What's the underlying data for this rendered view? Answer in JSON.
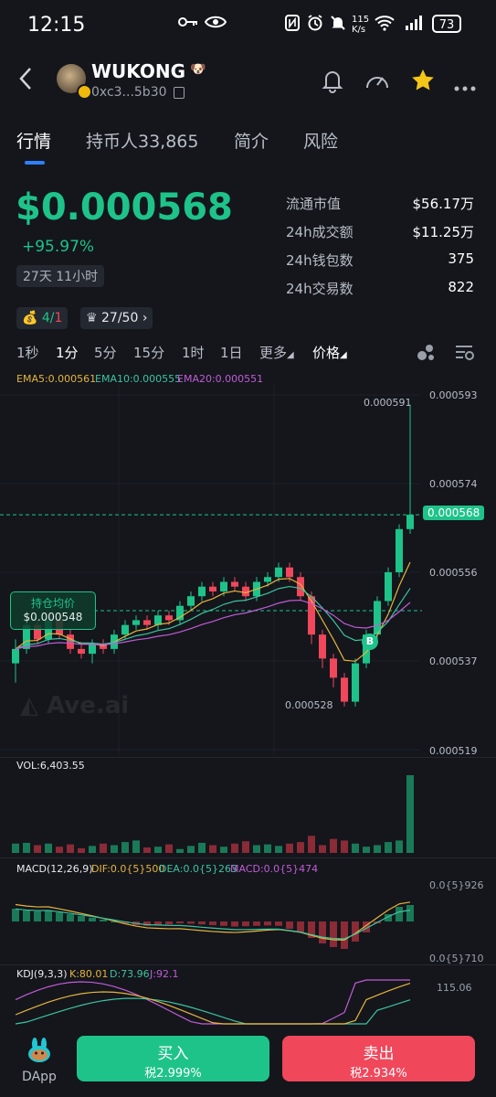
{
  "status_bar": {
    "time": "12:15",
    "net_speed": "115 K/s",
    "battery": "73"
  },
  "header": {
    "title": "WUKONG",
    "address": "0xc3...5b30"
  },
  "tabs": [
    {
      "label": "行情"
    },
    {
      "label": "持币人33,865"
    },
    {
      "label": "简介"
    },
    {
      "label": "风险"
    }
  ],
  "price": {
    "value": "$0.000568",
    "change": "+95.97%",
    "age": "27天 11小时"
  },
  "stats": [
    {
      "label": "流通市值",
      "value": "$56.17万"
    },
    {
      "label": "24h成交额",
      "value": "$11.25万"
    },
    {
      "label": "24h钱包数",
      "value": "375"
    },
    {
      "label": "24h交易数",
      "value": "822"
    }
  ],
  "pills": {
    "moneybag_a": "4/",
    "moneybag_b": "1",
    "crown": "27/50"
  },
  "timeframes": [
    "1秒",
    "1分",
    "5分",
    "15分",
    "1时",
    "1日",
    "更多",
    "价格"
  ],
  "ema": {
    "ema5": "EMA5:0.000561",
    "ema10": "EMA10:0.000555",
    "ema20": "EMA20:0.000551"
  },
  "chart_labels": {
    "high": "0.000591",
    "low": "0.000528",
    "current": "0.000568",
    "avg_title": "持仓均价",
    "avg_value": "$0.000548",
    "buy_marker": "B",
    "watermark": "Ave.ai"
  },
  "vol_label": "VOL:6,403.55",
  "macd": {
    "title": "MACD(12,26,9)",
    "dif": "DIF:0.0{5}500",
    "dea": "DEA:0.0{5}263",
    "macd": "MACD:0.0{5}474",
    "top": "0.0{5}926",
    "bottom": "0.0{5}710"
  },
  "kdj": {
    "title": "KDJ(9,3,3)",
    "k": "K:80.01",
    "d": "D:73.96",
    "j": "J:92.1",
    "top": "115.06"
  },
  "bottom_bar": {
    "dapp": "DApp",
    "buy": "买入",
    "buy_tax": "税2.999%",
    "sell": "卖出",
    "sell_tax": "税2.934%"
  },
  "colors": {
    "up": "#1ec38a",
    "down": "#f0475b",
    "accent": "#2f7fff",
    "ema5": "#e6b43c",
    "ema10": "#3cc3a0",
    "ema20": "#c25bd6"
  },
  "chart_data": {
    "type": "candlestick",
    "y_axis_ticks": [
      "0.000593",
      "0.000574",
      "0.000556",
      "0.000537",
      "0.000519"
    ],
    "ylim": [
      0.000519,
      0.000593
    ],
    "candles": [
      [
        0.000537,
        0.00054,
        0.000533,
        0.000542
      ],
      [
        0.00054,
        0.000545,
        0.000539,
        0.000547
      ],
      [
        0.000545,
        0.000542,
        0.000541,
        0.000546
      ],
      [
        0.000542,
        0.000546,
        0.000541,
        0.000547
      ],
      [
        0.000546,
        0.000543,
        0.000542,
        0.000547
      ],
      [
        0.000543,
        0.00054,
        0.000539,
        0.000544
      ],
      [
        0.00054,
        0.000539,
        0.000538,
        0.000541
      ],
      [
        0.000539,
        0.000541,
        0.000537,
        0.000542
      ],
      [
        0.000541,
        0.00054,
        0.000539,
        0.000542
      ],
      [
        0.00054,
        0.000543,
        0.000539,
        0.000544
      ],
      [
        0.000543,
        0.000545,
        0.000542,
        0.000546
      ],
      [
        0.000545,
        0.000546,
        0.000544,
        0.000547
      ],
      [
        0.000546,
        0.000545,
        0.000544,
        0.000547
      ],
      [
        0.000545,
        0.000547,
        0.000544,
        0.000548
      ],
      [
        0.000547,
        0.000546,
        0.000545,
        0.000548
      ],
      [
        0.000546,
        0.000549,
        0.000545,
        0.00055
      ],
      [
        0.000549,
        0.000551,
        0.000548,
        0.000552
      ],
      [
        0.000551,
        0.000553,
        0.00055,
        0.000554
      ],
      [
        0.000553,
        0.000552,
        0.000551,
        0.000554
      ],
      [
        0.000552,
        0.000554,
        0.000551,
        0.000555
      ],
      [
        0.000554,
        0.000553,
        0.000552,
        0.000555
      ],
      [
        0.000553,
        0.000551,
        0.00055,
        0.000554
      ],
      [
        0.000551,
        0.000554,
        0.00055,
        0.000555
      ],
      [
        0.000554,
        0.000555,
        0.000553,
        0.000556
      ],
      [
        0.000555,
        0.000557,
        0.000554,
        0.000558
      ],
      [
        0.000557,
        0.000555,
        0.000554,
        0.000558
      ],
      [
        0.000555,
        0.000551,
        0.00055,
        0.000556
      ],
      [
        0.000551,
        0.000543,
        0.000541,
        0.000552
      ],
      [
        0.000543,
        0.000538,
        0.000536,
        0.000544
      ],
      [
        0.000538,
        0.000534,
        0.000532,
        0.000539
      ],
      [
        0.000534,
        0.000529,
        0.000528,
        0.000535
      ],
      [
        0.000529,
        0.000537,
        0.000528,
        0.000538
      ],
      [
        0.000537,
        0.000543,
        0.000536,
        0.000544
      ],
      [
        0.000543,
        0.00055,
        0.000542,
        0.000551
      ],
      [
        0.00055,
        0.000556,
        0.000549,
        0.000557
      ],
      [
        0.000556,
        0.000565,
        0.000555,
        0.000566
      ],
      [
        0.000565,
        0.000568,
        0.000564,
        0.000591
      ]
    ],
    "volume_peak": 6403.55,
    "volume": [
      0.12,
      0.13,
      0.1,
      0.12,
      0.08,
      0.11,
      0.06,
      0.09,
      0.12,
      0.1,
      0.14,
      0.16,
      0.07,
      0.08,
      0.11,
      0.05,
      0.09,
      0.13,
      0.1,
      0.08,
      0.12,
      0.15,
      0.1,
      0.11,
      0.09,
      0.12,
      0.14,
      0.22,
      0.1,
      0.18,
      0.16,
      0.12,
      0.08,
      0.1,
      0.14,
      0.16,
      1.0
    ],
    "macd_hist": [
      0.35,
      0.3,
      0.28,
      0.3,
      0.25,
      0.2,
      0.15,
      0.1,
      0.05,
      0.0,
      -0.06,
      -0.1,
      -0.12,
      -0.1,
      -0.08,
      -0.05,
      -0.06,
      -0.08,
      -0.1,
      -0.12,
      -0.14,
      -0.13,
      -0.12,
      -0.11,
      -0.12,
      -0.2,
      -0.3,
      -0.45,
      -0.6,
      -0.7,
      -0.75,
      -0.55,
      -0.3,
      -0.05,
      0.2,
      0.4,
      0.45
    ]
  }
}
